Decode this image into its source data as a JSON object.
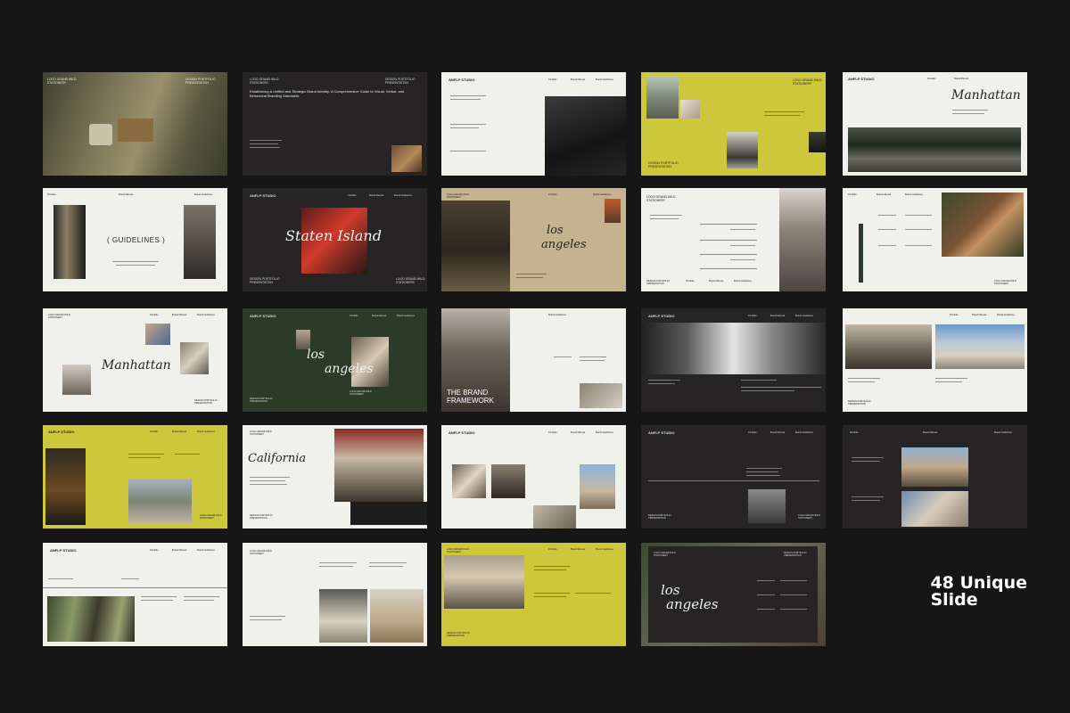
{
  "studio": "ANFLP STUDIO",
  "nav": [
    "Portfolio",
    "Brand Manual",
    "Brand Guidelines"
  ],
  "brand_top": "LOGO GRAND WILD\nSTATIONERY",
  "portfolio": "DESIGN PORTFOLIO\nPRESENTATION",
  "headline": "Establishing a Unified and Strategic Brand Identity: A Comprehensive Guide to Visual, Verbal, and Behavioral Branding Standards",
  "guidelines": "( GUIDELINES )",
  "scripts": {
    "manhattan": "Manhattan",
    "staten": "Staten Island",
    "la_los": "los",
    "la_angeles": "angeles",
    "california": "California"
  },
  "brand_framework": "THE BRAND\nFRAMEWORK",
  "feature_label": "48 Unique\nSlide",
  "colors": {
    "background": "#161616",
    "light": "#f1f1ec",
    "dark": "#262424",
    "olive": "#cdc73b",
    "green": "#2b3b27",
    "tan": "#c5b28f"
  }
}
